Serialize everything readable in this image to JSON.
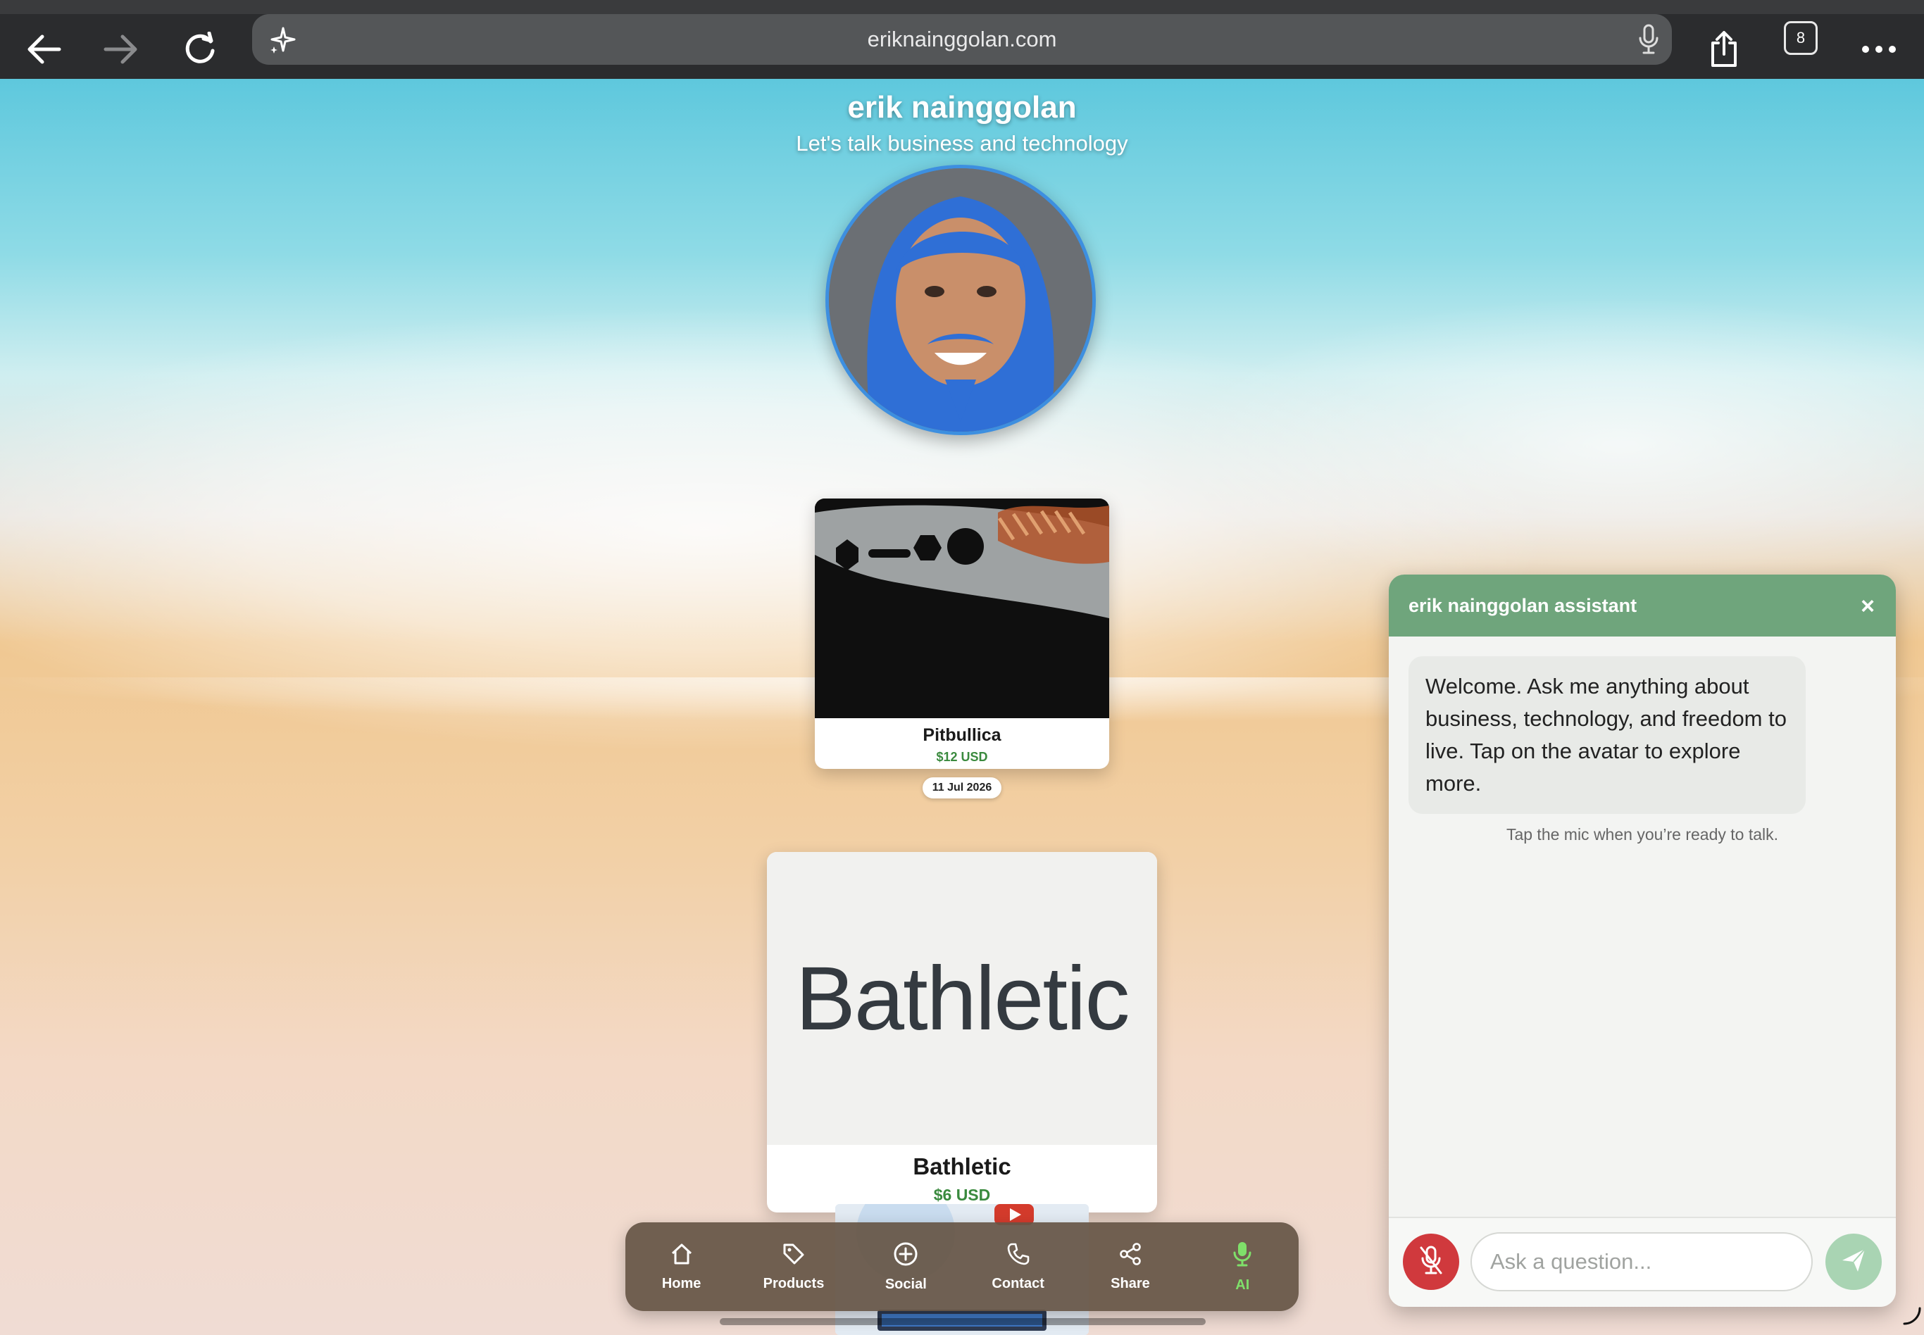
{
  "browser": {
    "url": "eriknainggolan.com",
    "tab_count": "8",
    "icons": [
      "back-arrow-icon",
      "forward-arrow-icon",
      "reload-icon",
      "sparkle-icon",
      "mic-icon",
      "share-icon",
      "tabs-icon",
      "more-icon"
    ]
  },
  "header": {
    "title": "erik nainggolan",
    "subtitle": "Let's talk business and technology"
  },
  "products": [
    {
      "name": "Pitbullica",
      "price": "$12 USD",
      "date": "11 Jul 2026"
    },
    {
      "name": "Bathletic",
      "price": "$6 USD",
      "logo_text": "Bathletic"
    }
  ],
  "nav": {
    "items": [
      {
        "label": "Home",
        "icon": "home-icon"
      },
      {
        "label": "Products",
        "icon": "tag-icon"
      },
      {
        "label": "Social",
        "icon": "plus-circle-icon"
      },
      {
        "label": "Contact",
        "icon": "phone-icon"
      },
      {
        "label": "Share",
        "icon": "share-nodes-icon"
      },
      {
        "label": "AI",
        "icon": "mic-icon"
      }
    ],
    "active": "AI"
  },
  "assistant": {
    "title": "erik nainggolan assistant",
    "close_label": "×",
    "welcome": "Welcome. Ask me anything about business, technology, and freedom to live. Tap on the avatar to explore more.",
    "hint": "Tap the mic when you’re ready to talk.",
    "input_placeholder": "Ask a question...",
    "input_value": ""
  },
  "colors": {
    "assistant_header": "#6fa57c",
    "mic_button": "#d0393d",
    "send_button": "#a9d4b3",
    "price_green": "#3a8a3e",
    "nav_active": "#7fe06a",
    "avatar_ring": "#3d8fe0"
  }
}
